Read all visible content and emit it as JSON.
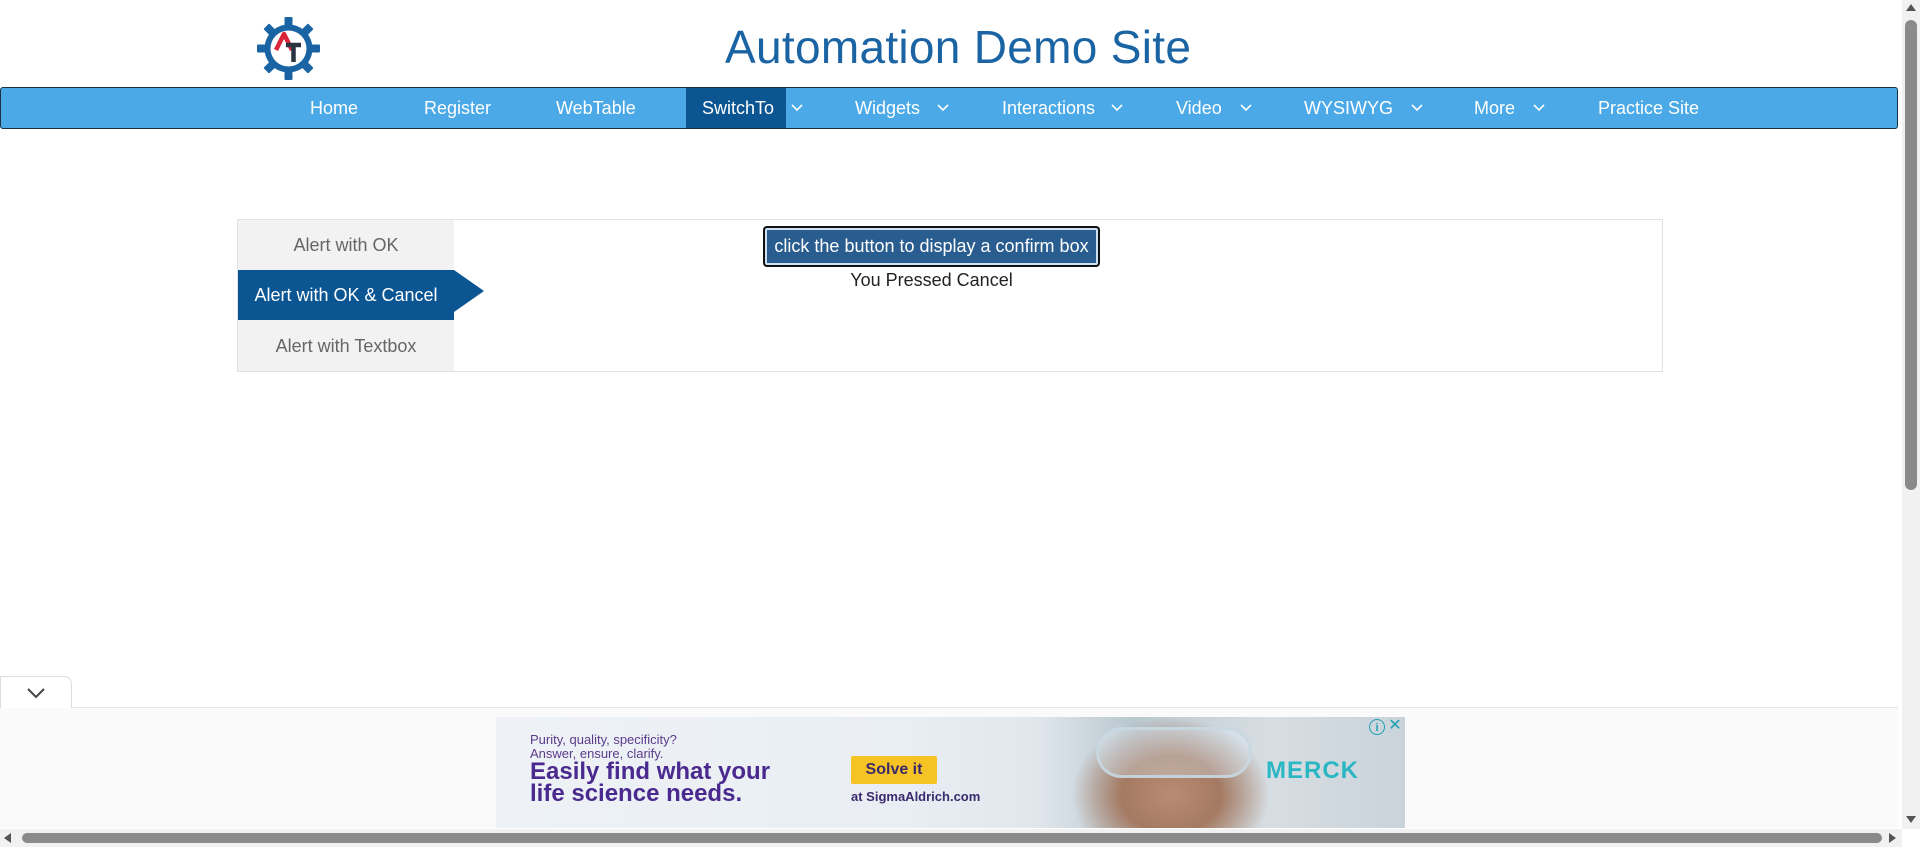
{
  "header": {
    "title": "Automation Demo Site",
    "logo_letters": "AT"
  },
  "nav": {
    "items": [
      {
        "label": "Home",
        "dropdown": false,
        "active": false
      },
      {
        "label": "Register",
        "dropdown": false,
        "active": false
      },
      {
        "label": "WebTable",
        "dropdown": false,
        "active": false
      },
      {
        "label": "SwitchTo",
        "dropdown": true,
        "active": true
      },
      {
        "label": "Widgets",
        "dropdown": true,
        "active": false
      },
      {
        "label": "Interactions",
        "dropdown": true,
        "active": false
      },
      {
        "label": "Video",
        "dropdown": true,
        "active": false
      },
      {
        "label": "WYSIWYG",
        "dropdown": true,
        "active": false
      },
      {
        "label": "More",
        "dropdown": true,
        "active": false
      },
      {
        "label": "Practice Site",
        "dropdown": false,
        "active": false
      }
    ]
  },
  "alerts": {
    "tabs": [
      {
        "label": "Alert with OK",
        "active": false
      },
      {
        "label": "Alert with OK & Cancel",
        "active": true
      },
      {
        "label": "Alert with Textbox",
        "active": false
      }
    ],
    "button_label": "click the button to display a confirm box",
    "result_text": "You Pressed Cancel"
  },
  "ad": {
    "small_line1": "Purity, quality, specificity?",
    "small_line2": "Answer, ensure, clarify.",
    "headline1": "Easily find what your",
    "headline2": "life science needs.",
    "cta": "Solve it",
    "url": "at SigmaAldrich.com",
    "brand": "MERCK",
    "info_icon": "info-icon",
    "close_icon": "close-icon"
  },
  "colors": {
    "nav_bg": "#4aa9e6",
    "nav_active": "#0b5593",
    "title": "#1b64a4",
    "button_bg": "#2a5d8f"
  }
}
